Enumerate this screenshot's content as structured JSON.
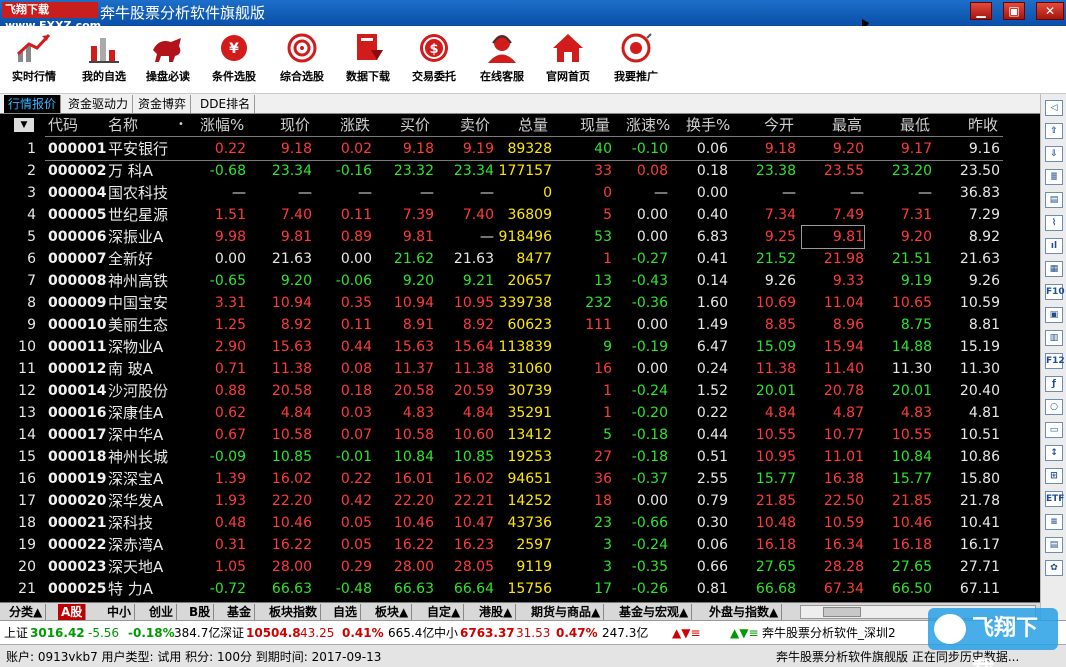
{
  "window": {
    "badge": "飞翔下载 www.FXXZ.com",
    "title": "奔牛股票分析软件旗舰版",
    "controls": [
      "▁",
      "▣",
      "✕"
    ]
  },
  "toolbar": [
    {
      "label": "实时行情",
      "icon": "chart-up-icon"
    },
    {
      "label": "我的自选",
      "icon": "bar-chart-icon"
    },
    {
      "label": "操盘必读",
      "icon": "bull-icon"
    },
    {
      "label": "条件选股",
      "icon": "filter-icon"
    },
    {
      "label": "综合选股",
      "icon": "target-icon"
    },
    {
      "label": "数据下载",
      "icon": "download-icon"
    },
    {
      "label": "交易委托",
      "icon": "yuan-coin-icon"
    },
    {
      "label": "在线客服",
      "icon": "agent-icon"
    },
    {
      "label": "官网首页",
      "icon": "home-icon"
    },
    {
      "label": "我要推广",
      "icon": "share-icon"
    }
  ],
  "subtabs": [
    "行情报价",
    "资金驱动力",
    "资金博弈",
    "DDE排名"
  ],
  "columns": [
    "代码",
    "名称",
    "•",
    "涨幅%",
    "现价",
    "涨跌",
    "买价",
    "卖价",
    "总量",
    "现量",
    "涨速%",
    "换手%",
    "今开",
    "最高",
    "最低",
    "昨收"
  ],
  "sort_button": "▼",
  "colors": {
    "red": "#ff3b3b",
    "green": "#2ce52c",
    "white": "#e8e8e8",
    "yellow": "#ffe800",
    "cyan": "#00e5e5",
    "code": "#f0f0f0"
  },
  "rows": [
    {
      "n": "1",
      "code": "000001",
      "name": "平安银行",
      "chg": "0.22",
      "price": "9.18",
      "diff": "0.02",
      "bid": "9.18",
      "ask": "9.19",
      "vol": "89328",
      "cur": "40",
      "speed": "-0.10",
      "turn": "0.06",
      "open": "9.18",
      "high": "9.20",
      "low": "9.17",
      "prev": "9.16",
      "c": [
        "r",
        "r",
        "r",
        "r",
        "r",
        "y",
        "g",
        "g",
        "w",
        "r",
        "r",
        "r",
        "w"
      ]
    },
    {
      "n": "2",
      "code": "000002",
      "name": "万 科A",
      "chg": "-0.68",
      "price": "23.34",
      "diff": "-0.16",
      "bid": "23.32",
      "ask": "23.34",
      "vol": "177157",
      "cur": "33",
      "speed": "0.08",
      "turn": "0.18",
      "open": "23.38",
      "high": "23.55",
      "low": "23.20",
      "prev": "23.50",
      "c": [
        "g",
        "g",
        "g",
        "g",
        "g",
        "y",
        "r",
        "r",
        "w",
        "g",
        "r",
        "g",
        "w"
      ]
    },
    {
      "n": "3",
      "code": "000004",
      "name": "国农科技",
      "chg": "—",
      "price": "—",
      "diff": "—",
      "bid": "—",
      "ask": "—",
      "vol": "0",
      "cur": "0",
      "speed": "—",
      "turn": "0.00",
      "open": "—",
      "high": "—",
      "low": "—",
      "prev": "36.83",
      "c": [
        "w",
        "w",
        "w",
        "w",
        "w",
        "y",
        "r",
        "w",
        "w",
        "w",
        "w",
        "w",
        "w"
      ]
    },
    {
      "n": "4",
      "code": "000005",
      "name": "世纪星源",
      "chg": "1.51",
      "price": "7.40",
      "diff": "0.11",
      "bid": "7.39",
      "ask": "7.40",
      "vol": "36809",
      "cur": "5",
      "speed": "0.00",
      "turn": "0.40",
      "open": "7.34",
      "high": "7.49",
      "low": "7.31",
      "prev": "7.29",
      "c": [
        "r",
        "r",
        "r",
        "r",
        "r",
        "y",
        "r",
        "w",
        "w",
        "r",
        "r",
        "r",
        "w"
      ]
    },
    {
      "n": "5",
      "code": "000006",
      "name": "深振业A",
      "chg": "9.98",
      "price": "9.81",
      "diff": "0.89",
      "bid": "9.81",
      "ask": "—",
      "vol": "918496",
      "cur": "53",
      "speed": "0.00",
      "turn": "6.83",
      "open": "9.25",
      "high": "9.81",
      "low": "9.20",
      "prev": "8.92",
      "c": [
        "r",
        "r",
        "r",
        "r",
        "w",
        "y",
        "g",
        "w",
        "w",
        "r",
        "r",
        "r",
        "w"
      ]
    },
    {
      "n": "6",
      "code": "000007",
      "name": "全新好",
      "chg": "0.00",
      "price": "21.63",
      "diff": "0.00",
      "bid": "21.62",
      "ask": "21.63",
      "vol": "8477",
      "cur": "1",
      "speed": "-0.27",
      "turn": "0.41",
      "open": "21.52",
      "high": "21.98",
      "low": "21.51",
      "prev": "21.63",
      "c": [
        "w",
        "w",
        "w",
        "g",
        "w",
        "y",
        "r",
        "g",
        "w",
        "g",
        "r",
        "g",
        "w"
      ]
    },
    {
      "n": "7",
      "code": "000008",
      "name": "神州高铁",
      "chg": "-0.65",
      "price": "9.20",
      "diff": "-0.06",
      "bid": "9.20",
      "ask": "9.21",
      "vol": "20657",
      "cur": "13",
      "speed": "-0.43",
      "turn": "0.14",
      "open": "9.26",
      "high": "9.33",
      "low": "9.19",
      "prev": "9.26",
      "c": [
        "g",
        "g",
        "g",
        "g",
        "g",
        "y",
        "g",
        "g",
        "w",
        "w",
        "r",
        "g",
        "w"
      ]
    },
    {
      "n": "8",
      "code": "000009",
      "name": "中国宝安",
      "chg": "3.31",
      "price": "10.94",
      "diff": "0.35",
      "bid": "10.94",
      "ask": "10.95",
      "vol": "339738",
      "cur": "232",
      "speed": "-0.36",
      "turn": "1.60",
      "open": "10.69",
      "high": "11.04",
      "low": "10.65",
      "prev": "10.59",
      "c": [
        "r",
        "r",
        "r",
        "r",
        "r",
        "y",
        "g",
        "g",
        "w",
        "r",
        "r",
        "r",
        "w"
      ]
    },
    {
      "n": "9",
      "code": "000010",
      "name": "美丽生态",
      "chg": "1.25",
      "price": "8.92",
      "diff": "0.11",
      "bid": "8.91",
      "ask": "8.92",
      "vol": "60623",
      "cur": "111",
      "speed": "0.00",
      "turn": "1.49",
      "open": "8.85",
      "high": "8.96",
      "low": "8.75",
      "prev": "8.81",
      "c": [
        "r",
        "r",
        "r",
        "r",
        "r",
        "y",
        "r",
        "w",
        "w",
        "r",
        "r",
        "g",
        "w"
      ]
    },
    {
      "n": "10",
      "code": "000011",
      "name": "深物业A",
      "chg": "2.90",
      "price": "15.63",
      "diff": "0.44",
      "bid": "15.63",
      "ask": "15.64",
      "vol": "113839",
      "cur": "9",
      "speed": "-0.19",
      "turn": "6.47",
      "open": "15.09",
      "high": "15.94",
      "low": "14.88",
      "prev": "15.19",
      "c": [
        "r",
        "r",
        "r",
        "r",
        "r",
        "y",
        "g",
        "g",
        "w",
        "g",
        "r",
        "g",
        "w"
      ]
    },
    {
      "n": "11",
      "code": "000012",
      "name": "南 玻A",
      "chg": "0.71",
      "price": "11.38",
      "diff": "0.08",
      "bid": "11.37",
      "ask": "11.38",
      "vol": "31060",
      "cur": "16",
      "speed": "0.00",
      "turn": "0.24",
      "open": "11.38",
      "high": "11.40",
      "low": "11.30",
      "prev": "11.30",
      "c": [
        "r",
        "r",
        "r",
        "r",
        "r",
        "y",
        "r",
        "w",
        "w",
        "r",
        "r",
        "w",
        "w"
      ]
    },
    {
      "n": "12",
      "code": "000014",
      "name": "沙河股份",
      "chg": "0.88",
      "price": "20.58",
      "diff": "0.18",
      "bid": "20.58",
      "ask": "20.59",
      "vol": "30739",
      "cur": "1",
      "speed": "-0.24",
      "turn": "1.52",
      "open": "20.01",
      "high": "20.78",
      "low": "20.01",
      "prev": "20.40",
      "c": [
        "r",
        "r",
        "r",
        "r",
        "r",
        "y",
        "r",
        "g",
        "w",
        "g",
        "r",
        "g",
        "w"
      ]
    },
    {
      "n": "13",
      "code": "000016",
      "name": "深康佳A",
      "chg": "0.62",
      "price": "4.84",
      "diff": "0.03",
      "bid": "4.83",
      "ask": "4.84",
      "vol": "35291",
      "cur": "1",
      "speed": "-0.20",
      "turn": "0.22",
      "open": "4.84",
      "high": "4.87",
      "low": "4.83",
      "prev": "4.81",
      "c": [
        "r",
        "r",
        "r",
        "r",
        "r",
        "y",
        "r",
        "g",
        "w",
        "r",
        "r",
        "r",
        "w"
      ]
    },
    {
      "n": "14",
      "code": "000017",
      "name": "深中华A",
      "chg": "0.67",
      "price": "10.58",
      "diff": "0.07",
      "bid": "10.58",
      "ask": "10.60",
      "vol": "13412",
      "cur": "5",
      "speed": "-0.18",
      "turn": "0.44",
      "open": "10.55",
      "high": "10.77",
      "low": "10.55",
      "prev": "10.51",
      "c": [
        "r",
        "r",
        "r",
        "r",
        "r",
        "y",
        "g",
        "g",
        "w",
        "r",
        "r",
        "r",
        "w"
      ]
    },
    {
      "n": "15",
      "code": "000018",
      "name": "神州长城",
      "chg": "-0.09",
      "price": "10.85",
      "diff": "-0.01",
      "bid": "10.84",
      "ask": "10.85",
      "vol": "19253",
      "cur": "27",
      "speed": "-0.18",
      "turn": "0.51",
      "open": "10.95",
      "high": "11.01",
      "low": "10.84",
      "prev": "10.86",
      "c": [
        "g",
        "g",
        "g",
        "g",
        "g",
        "y",
        "r",
        "g",
        "w",
        "r",
        "r",
        "g",
        "w"
      ]
    },
    {
      "n": "16",
      "code": "000019",
      "name": "深深宝A",
      "chg": "1.39",
      "price": "16.02",
      "diff": "0.22",
      "bid": "16.01",
      "ask": "16.02",
      "vol": "94651",
      "cur": "36",
      "speed": "-0.37",
      "turn": "2.55",
      "open": "15.77",
      "high": "16.38",
      "low": "15.77",
      "prev": "15.80",
      "c": [
        "r",
        "r",
        "r",
        "r",
        "r",
        "y",
        "r",
        "g",
        "w",
        "g",
        "r",
        "g",
        "w"
      ]
    },
    {
      "n": "17",
      "code": "000020",
      "name": "深华发A",
      "chg": "1.93",
      "price": "22.20",
      "diff": "0.42",
      "bid": "22.20",
      "ask": "22.21",
      "vol": "14252",
      "cur": "18",
      "speed": "0.00",
      "turn": "0.79",
      "open": "21.85",
      "high": "22.50",
      "low": "21.85",
      "prev": "21.78",
      "c": [
        "r",
        "r",
        "r",
        "r",
        "r",
        "y",
        "r",
        "w",
        "w",
        "r",
        "r",
        "r",
        "w"
      ]
    },
    {
      "n": "18",
      "code": "000021",
      "name": "深科技",
      "chg": "0.48",
      "price": "10.46",
      "diff": "0.05",
      "bid": "10.46",
      "ask": "10.47",
      "vol": "43736",
      "cur": "23",
      "speed": "-0.66",
      "turn": "0.30",
      "open": "10.48",
      "high": "10.59",
      "low": "10.46",
      "prev": "10.41",
      "c": [
        "r",
        "r",
        "r",
        "r",
        "r",
        "y",
        "g",
        "g",
        "w",
        "r",
        "r",
        "r",
        "w"
      ]
    },
    {
      "n": "19",
      "code": "000022",
      "name": "深赤湾A",
      "chg": "0.31",
      "price": "16.22",
      "diff": "0.05",
      "bid": "16.22",
      "ask": "16.23",
      "vol": "2597",
      "cur": "3",
      "speed": "-0.24",
      "turn": "0.06",
      "open": "16.18",
      "high": "16.34",
      "low": "16.18",
      "prev": "16.17",
      "c": [
        "r",
        "r",
        "r",
        "r",
        "r",
        "y",
        "g",
        "g",
        "w",
        "r",
        "r",
        "r",
        "w"
      ]
    },
    {
      "n": "20",
      "code": "000023",
      "name": "深天地A",
      "chg": "1.05",
      "price": "28.00",
      "diff": "0.29",
      "bid": "28.00",
      "ask": "28.05",
      "vol": "9119",
      "cur": "3",
      "speed": "-0.35",
      "turn": "0.66",
      "open": "27.65",
      "high": "28.28",
      "low": "27.65",
      "prev": "27.71",
      "c": [
        "r",
        "r",
        "r",
        "r",
        "r",
        "y",
        "g",
        "g",
        "w",
        "g",
        "r",
        "g",
        "w"
      ]
    },
    {
      "n": "21",
      "code": "000025",
      "name": "特 力A",
      "chg": "-0.72",
      "price": "66.63",
      "diff": "-0.48",
      "bid": "66.63",
      "ask": "66.64",
      "vol": "15756",
      "cur": "17",
      "speed": "-0.26",
      "turn": "0.81",
      "open": "66.68",
      "high": "67.34",
      "low": "66.50",
      "prev": "67.11",
      "c": [
        "g",
        "g",
        "g",
        "g",
        "g",
        "y",
        "g",
        "g",
        "w",
        "g",
        "r",
        "g",
        "w"
      ]
    }
  ],
  "bottom_tabs": [
    "分类▲",
    "A股",
    "中小",
    "创业",
    "B股",
    "基金",
    "板块指数",
    "自选",
    "板块▲",
    "自定▲",
    "港股▲",
    "期货与商品▲",
    "基金与宏观▲",
    "外盘与指数▲"
  ],
  "index_bar": {
    "sh_label": "上证",
    "sh_val": "3016.42",
    "sh_chg": "-5.56",
    "sh_pct": "-0.18%",
    "sh_amt": "384.7亿",
    "sz_label": "深证",
    "sz_val": "10504.8",
    "sz_chg": "43.25",
    "sz_pct": "0.41%",
    "sz_amt": "665.4亿",
    "zx_label": "中小",
    "zx_val": "6763.37",
    "zx_chg": "31.53",
    "zx_pct": "0.47%",
    "zx_amt": "247.3亿",
    "marquee": "奔牛股票分析软件_深圳2"
  },
  "status": {
    "account": "账户: 0913vkb7 用户类型: 试用 积分: 100分 到期时间: 2017-09-13",
    "message": "奔牛股票分析软件旗舰版     正在同步历史数据..."
  },
  "watermark": "飞翔下载"
}
